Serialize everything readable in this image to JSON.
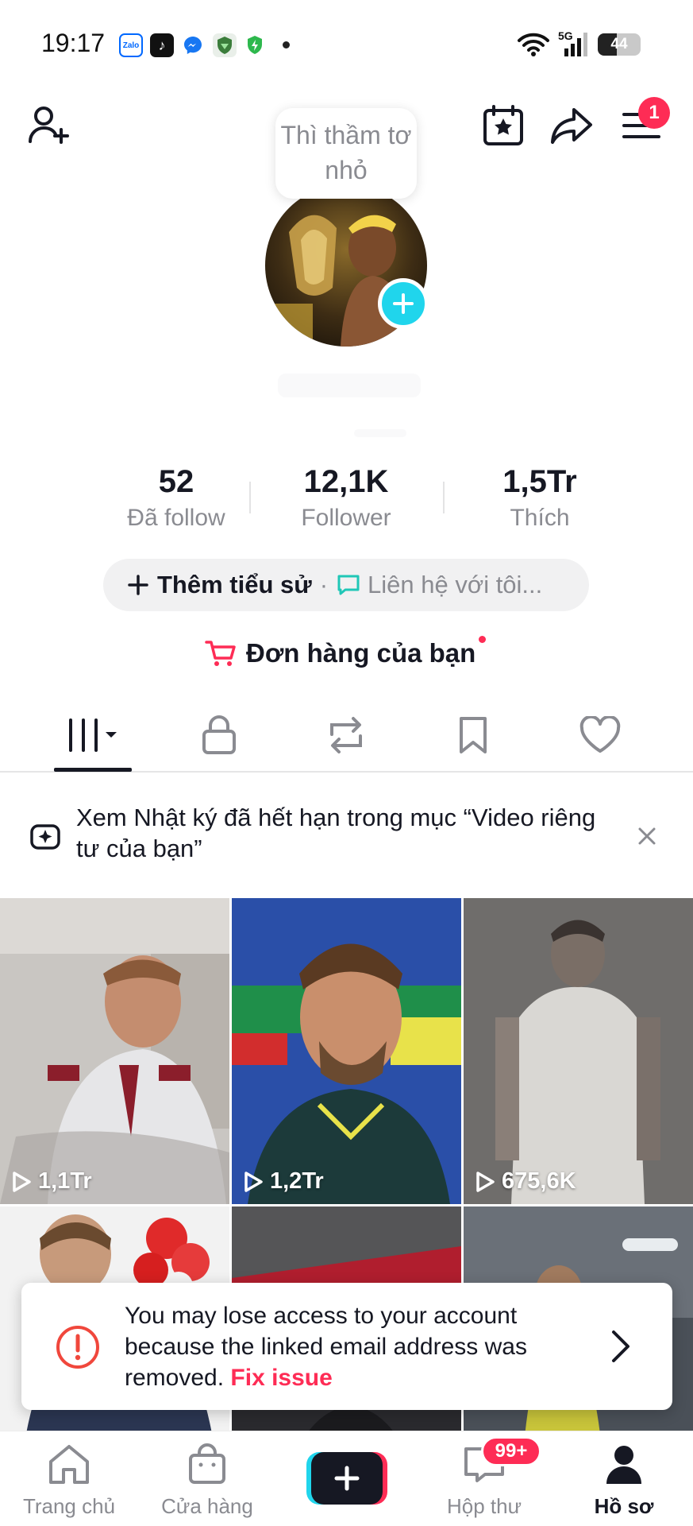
{
  "status_bar": {
    "time": "19:17",
    "network": "5G",
    "battery": "44",
    "apps": [
      {
        "name": "zalo-icon",
        "label": "Zalo",
        "color": "#0068ff"
      },
      {
        "name": "tiktok-icon",
        "label": "♪",
        "color": "#111111"
      },
      {
        "name": "messenger-icon",
        "label": "",
        "color": "#1877f2"
      },
      {
        "name": "vpn-shield-icon",
        "label": "",
        "color": "#3b7d3b"
      },
      {
        "name": "security-shield-icon",
        "label": "",
        "color": "#2db84d"
      }
    ]
  },
  "header": {
    "notification_count": "1"
  },
  "profile": {
    "note_bubble": "Thì thầm tơ nhỏ"
  },
  "stats": [
    {
      "value": "52",
      "label": "Đã follow"
    },
    {
      "value": "12,1K",
      "label": "Follower"
    },
    {
      "value": "1,5Tr",
      "label": "Thích"
    }
  ],
  "bio": {
    "add_bio": "Thêm tiểu sử",
    "separator": "·",
    "contact": "Liên hệ với tôi..."
  },
  "orders": {
    "label": "Đơn hàng của bạn"
  },
  "tabs": [
    {
      "name": "videos",
      "icon": "grid-icon",
      "active": true
    },
    {
      "name": "private",
      "icon": "lock-icon"
    },
    {
      "name": "reposts",
      "icon": "repost-icon"
    },
    {
      "name": "favorites",
      "icon": "bookmark-icon"
    },
    {
      "name": "liked",
      "icon": "heart-icon"
    }
  ],
  "banner": {
    "text": "Xem Nhật ký đã hết hạn trong mục “Video riêng tư của bạn”"
  },
  "videos": [
    {
      "views": "1,1Tr"
    },
    {
      "views": "1,2Tr"
    },
    {
      "views": "675,6K"
    },
    {
      "views": ""
    },
    {
      "views": ""
    },
    {
      "views": ""
    }
  ],
  "toast": {
    "message": "You may lose access to your account because the linked email address was removed.",
    "action": "Fix issue"
  },
  "bottom_nav": {
    "home": "Trang chủ",
    "shop": "Cửa hàng",
    "inbox": "Hộp thư",
    "inbox_badge": "99+",
    "profile": "Hồ sơ"
  },
  "colors": {
    "accent": "#fe2c55",
    "cyan": "#20d5ec",
    "text": "#161823",
    "muted": "#8a8b91"
  }
}
